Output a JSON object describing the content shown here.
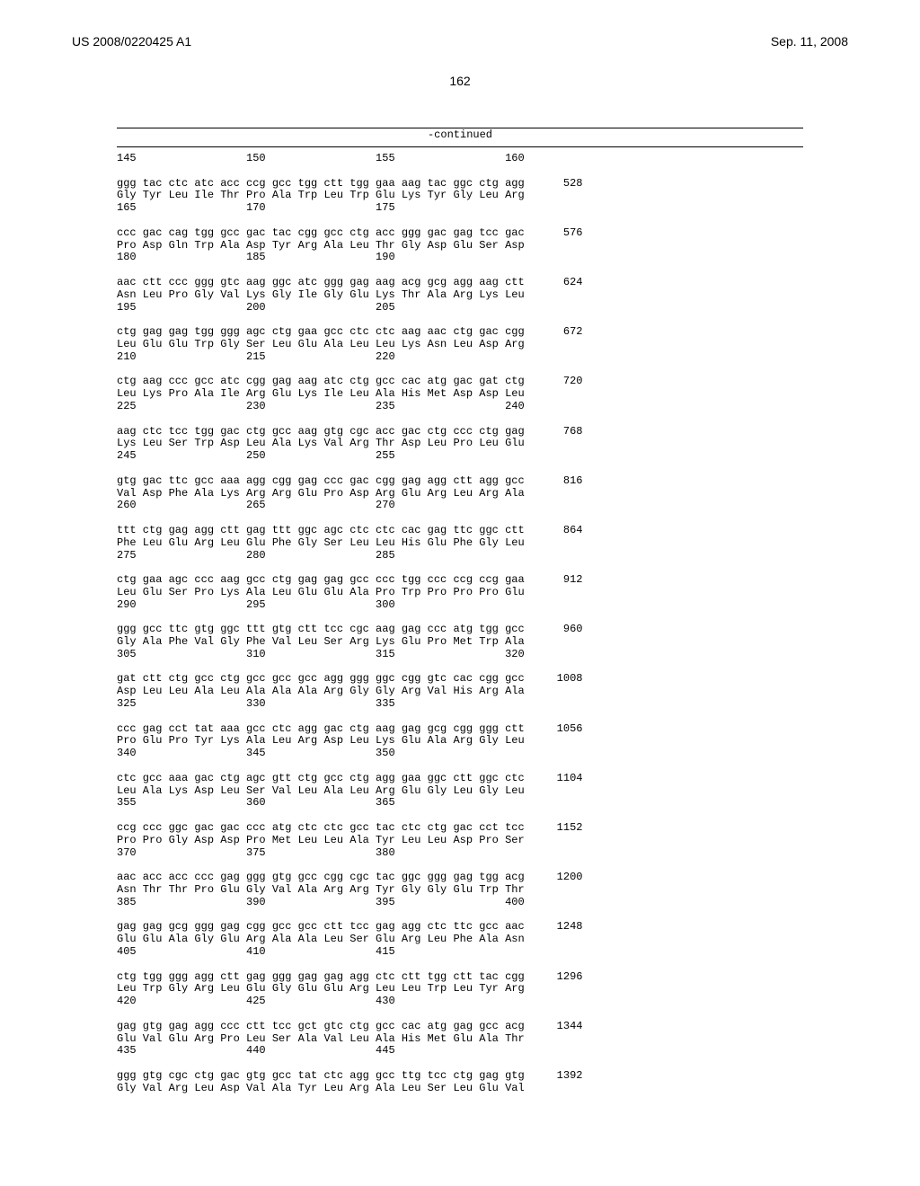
{
  "header": {
    "publication": "US 2008/0220425 A1",
    "date": "Sep. 11, 2008"
  },
  "page_number": "162",
  "continued": "-continued",
  "sequence_rows": [
    "145                 150                 155                 160",
    "",
    "ggg tac ctc atc acc ccg gcc tgg ctt tgg gaa aag tac ggc ctg agg      528",
    "Gly Tyr Leu Ile Thr Pro Ala Trp Leu Trp Glu Lys Tyr Gly Leu Arg",
    "165                 170                 175",
    "",
    "ccc gac cag tgg gcc gac tac cgg gcc ctg acc ggg gac gag tcc gac      576",
    "Pro Asp Gln Trp Ala Asp Tyr Arg Ala Leu Thr Gly Asp Glu Ser Asp",
    "180                 185                 190",
    "",
    "aac ctt ccc ggg gtc aag ggc atc ggg gag aag acg gcg agg aag ctt      624",
    "Asn Leu Pro Gly Val Lys Gly Ile Gly Glu Lys Thr Ala Arg Lys Leu",
    "195                 200                 205",
    "",
    "ctg gag gag tgg ggg agc ctg gaa gcc ctc ctc aag aac ctg gac cgg      672",
    "Leu Glu Glu Trp Gly Ser Leu Glu Ala Leu Leu Lys Asn Leu Asp Arg",
    "210                 215                 220",
    "",
    "ctg aag ccc gcc atc cgg gag aag atc ctg gcc cac atg gac gat ctg      720",
    "Leu Lys Pro Ala Ile Arg Glu Lys Ile Leu Ala His Met Asp Asp Leu",
    "225                 230                 235                 240",
    "",
    "aag ctc tcc tgg gac ctg gcc aag gtg cgc acc gac ctg ccc ctg gag      768",
    "Lys Leu Ser Trp Asp Leu Ala Lys Val Arg Thr Asp Leu Pro Leu Glu",
    "245                 250                 255",
    "",
    "gtg gac ttc gcc aaa agg cgg gag ccc gac cgg gag agg ctt agg gcc      816",
    "Val Asp Phe Ala Lys Arg Arg Glu Pro Asp Arg Glu Arg Leu Arg Ala",
    "260                 265                 270",
    "",
    "ttt ctg gag agg ctt gag ttt ggc agc ctc ctc cac gag ttc ggc ctt      864",
    "Phe Leu Glu Arg Leu Glu Phe Gly Ser Leu Leu His Glu Phe Gly Leu",
    "275                 280                 285",
    "",
    "ctg gaa agc ccc aag gcc ctg gag gag gcc ccc tgg ccc ccg ccg gaa      912",
    "Leu Glu Ser Pro Lys Ala Leu Glu Glu Ala Pro Trp Pro Pro Pro Glu",
    "290                 295                 300",
    "",
    "ggg gcc ttc gtg ggc ttt gtg ctt tcc cgc aag gag ccc atg tgg gcc      960",
    "Gly Ala Phe Val Gly Phe Val Leu Ser Arg Lys Glu Pro Met Trp Ala",
    "305                 310                 315                 320",
    "",
    "gat ctt ctg gcc ctg gcc gcc gcc agg ggg ggc cgg gtc cac cgg gcc     1008",
    "Asp Leu Leu Ala Leu Ala Ala Ala Arg Gly Gly Arg Val His Arg Ala",
    "325                 330                 335",
    "",
    "ccc gag cct tat aaa gcc ctc agg gac ctg aag gag gcg cgg ggg ctt     1056",
    "Pro Glu Pro Tyr Lys Ala Leu Arg Asp Leu Lys Glu Ala Arg Gly Leu",
    "340                 345                 350",
    "",
    "ctc gcc aaa gac ctg agc gtt ctg gcc ctg agg gaa ggc ctt ggc ctc     1104",
    "Leu Ala Lys Asp Leu Ser Val Leu Ala Leu Arg Glu Gly Leu Gly Leu",
    "355                 360                 365",
    "",
    "ccg ccc ggc gac gac ccc atg ctc ctc gcc tac ctc ctg gac cct tcc     1152",
    "Pro Pro Gly Asp Asp Pro Met Leu Leu Ala Tyr Leu Leu Asp Pro Ser",
    "370                 375                 380",
    "",
    "aac acc acc ccc gag ggg gtg gcc cgg cgc tac ggc ggg gag tgg acg     1200",
    "Asn Thr Thr Pro Glu Gly Val Ala Arg Arg Tyr Gly Gly Glu Trp Thr",
    "385                 390                 395                 400",
    "",
    "gag gag gcg ggg gag cgg gcc gcc ctt tcc gag agg ctc ttc gcc aac     1248",
    "Glu Glu Ala Gly Glu Arg Ala Ala Leu Ser Glu Arg Leu Phe Ala Asn",
    "405                 410                 415",
    "",
    "ctg tgg ggg agg ctt gag ggg gag gag agg ctc ctt tgg ctt tac cgg     1296",
    "Leu Trp Gly Arg Leu Glu Gly Glu Glu Arg Leu Leu Trp Leu Tyr Arg",
    "420                 425                 430",
    "",
    "gag gtg gag agg ccc ctt tcc gct gtc ctg gcc cac atg gag gcc acg     1344",
    "Glu Val Glu Arg Pro Leu Ser Ala Val Leu Ala His Met Glu Ala Thr",
    "435                 440                 445",
    "",
    "ggg gtg cgc ctg gac gtg gcc tat ctc agg gcc ttg tcc ctg gag gtg     1392",
    "Gly Val Arg Leu Asp Val Ala Tyr Leu Arg Ala Leu Ser Leu Glu Val"
  ]
}
